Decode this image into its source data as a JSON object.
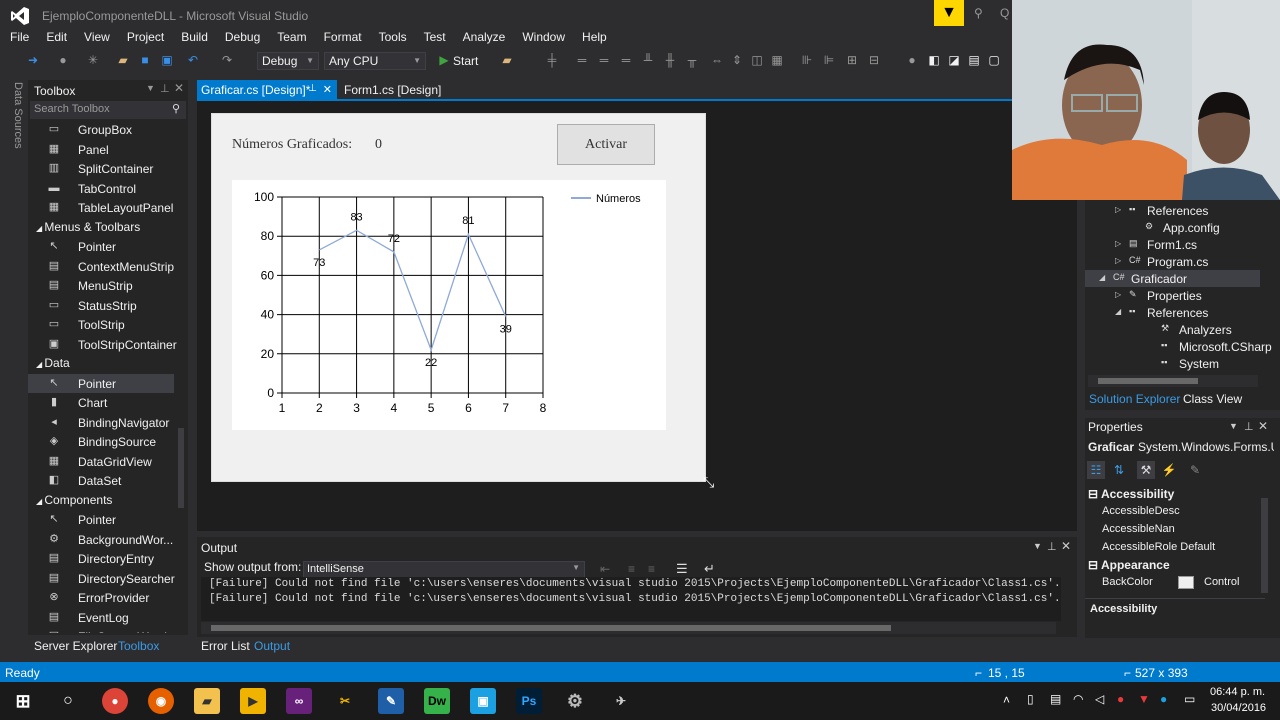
{
  "window": {
    "title": "EjemploComponenteDLL - Microsoft Visual Studio",
    "quick_launch": "Q"
  },
  "menu": [
    "File",
    "Edit",
    "View",
    "Project",
    "Build",
    "Debug",
    "Team",
    "Format",
    "Tools",
    "Test",
    "Analyze",
    "Window",
    "Help"
  ],
  "toolbar": {
    "config": "Debug",
    "platform": "Any CPU",
    "start_label": "Start"
  },
  "side_tab": "Data Sources",
  "toolbox": {
    "title": "Toolbox",
    "search_placeholder": "Search Toolbox",
    "items": [
      {
        "type": "item",
        "label": "GroupBox",
        "icon": "groupbox-icon",
        "glyph": "▭"
      },
      {
        "type": "item",
        "label": "Panel",
        "icon": "panel-icon",
        "glyph": "▦"
      },
      {
        "type": "item",
        "label": "SplitContainer",
        "icon": "splitcontainer-icon",
        "glyph": "▥"
      },
      {
        "type": "item",
        "label": "TabControl",
        "icon": "tabcontrol-icon",
        "glyph": "▬"
      },
      {
        "type": "item",
        "label": "TableLayoutPanel",
        "icon": "tablelayout-icon",
        "glyph": "▦"
      },
      {
        "type": "cat",
        "label": "Menus & Toolbars"
      },
      {
        "type": "item",
        "label": "Pointer",
        "icon": "pointer-icon",
        "glyph": "↖"
      },
      {
        "type": "item",
        "label": "ContextMenuStrip",
        "icon": "contextmenu-icon",
        "glyph": "▤"
      },
      {
        "type": "item",
        "label": "MenuStrip",
        "icon": "menustrip-icon",
        "glyph": "▤"
      },
      {
        "type": "item",
        "label": "StatusStrip",
        "icon": "statusstrip-icon",
        "glyph": "▭"
      },
      {
        "type": "item",
        "label": "ToolStrip",
        "icon": "toolstrip-icon",
        "glyph": "▭"
      },
      {
        "type": "item",
        "label": "ToolStripContainer",
        "icon": "toolstripcontainer-icon",
        "glyph": "▣"
      },
      {
        "type": "cat",
        "label": "Data"
      },
      {
        "type": "item",
        "label": "Pointer",
        "icon": "pointer-icon",
        "glyph": "↖",
        "selected": true
      },
      {
        "type": "item",
        "label": "Chart",
        "icon": "chart-icon",
        "glyph": "▮"
      },
      {
        "type": "item",
        "label": "BindingNavigator",
        "icon": "bindingnavigator-icon",
        "glyph": "◂"
      },
      {
        "type": "item",
        "label": "BindingSource",
        "icon": "bindingsource-icon",
        "glyph": "◈"
      },
      {
        "type": "item",
        "label": "DataGridView",
        "icon": "datagridview-icon",
        "glyph": "▦"
      },
      {
        "type": "item",
        "label": "DataSet",
        "icon": "dataset-icon",
        "glyph": "◧"
      },
      {
        "type": "cat",
        "label": "Components"
      },
      {
        "type": "item",
        "label": "Pointer",
        "icon": "pointer-icon",
        "glyph": "↖"
      },
      {
        "type": "item",
        "label": "BackgroundWor...",
        "icon": "backgroundworker-icon",
        "glyph": "⚙"
      },
      {
        "type": "item",
        "label": "DirectoryEntry",
        "icon": "directoryentry-icon",
        "glyph": "▤"
      },
      {
        "type": "item",
        "label": "DirectorySearcher",
        "icon": "directorysearcher-icon",
        "glyph": "▤"
      },
      {
        "type": "item",
        "label": "ErrorProvider",
        "icon": "errorprovider-icon",
        "glyph": "⊗"
      },
      {
        "type": "item",
        "label": "EventLog",
        "icon": "eventlog-icon",
        "glyph": "▤"
      },
      {
        "type": "item",
        "label": "FileSystemWatch...",
        "icon": "filesystemwatcher-icon",
        "glyph": "▤"
      }
    ]
  },
  "bottom_tabs": [
    "Server Explorer",
    "Toolbox"
  ],
  "doc_tabs": [
    "Graficar.cs [Design]*",
    "Form1.cs [Design]"
  ],
  "form": {
    "label": "Números Graficados:",
    "count": "0",
    "button": "Activar"
  },
  "chart_data": {
    "type": "line",
    "x": [
      1,
      2,
      3,
      4,
      5,
      6,
      7
    ],
    "series": [
      {
        "name": "Números",
        "values": [
          null,
          73,
          83,
          72,
          22,
          81,
          39
        ]
      }
    ],
    "data_labels": [
      "",
      "73",
      "83",
      "72",
      "22",
      "81",
      "39"
    ],
    "xlim": [
      1,
      8
    ],
    "ylim": [
      0,
      100
    ],
    "xticks": [
      "1",
      "2",
      "3",
      "4",
      "5",
      "6",
      "7",
      "8"
    ],
    "yticks": [
      "0",
      "20",
      "40",
      "60",
      "80",
      "100"
    ],
    "grid": true,
    "legend": "top-right",
    "line_color": "#8fa9d8"
  },
  "output": {
    "title": "Output",
    "show_from_label": "Show output from:",
    "source": "IntelliSense",
    "lines": [
      "[Failure] Could not find file 'c:\\users\\enseres\\documents\\visual studio 2015\\Projects\\EjemploComponenteDLL\\Graficador\\Class1.cs'.",
      "[Failure] Could not find file 'c:\\users\\enseres\\documents\\visual studio 2015\\Projects\\EjemploComponenteDLL\\Graficador\\Class1.cs'."
    ],
    "tabs": [
      "Error List",
      "Output"
    ]
  },
  "solution_explorer": {
    "items": [
      {
        "label": "References",
        "icon": "references-icon"
      },
      {
        "label": "App.config",
        "icon": "config-icon"
      },
      {
        "label": "Form1.cs",
        "icon": "form-icon"
      },
      {
        "label": "Program.cs",
        "icon": "csharp-icon"
      },
      {
        "label": "Graficador",
        "icon": "csharp-project-icon"
      },
      {
        "label": "Properties",
        "icon": "wrench-icon"
      },
      {
        "label": "References",
        "icon": "references-icon"
      },
      {
        "label": "Analyzers",
        "icon": "analyzers-icon"
      },
      {
        "label": "Microsoft.CSharp",
        "icon": "assembly-icon"
      },
      {
        "label": "System",
        "icon": "assembly-icon"
      }
    ],
    "tabs": [
      "Solution Explorer",
      "Class View"
    ]
  },
  "properties": {
    "title": "Properties",
    "object": "Graficar",
    "type": "System.Windows.Forms.U",
    "categories": {
      "accessibility": "Accessibility",
      "appearance": "Appearance"
    },
    "rows": [
      {
        "name": "AccessibleDesc",
        "value": ""
      },
      {
        "name": "AccessibleNan",
        "value": ""
      },
      {
        "name": "AccessibleRole",
        "value": "Default"
      }
    ],
    "backcolor": {
      "name": "BackColor",
      "value": "Control"
    },
    "description": "Accessibility"
  },
  "status": {
    "ready": "Ready",
    "position": "15 , 15",
    "size": "527 x 393"
  },
  "taskbar": {
    "time": "06:44 p. m.",
    "date": "30/04/2016"
  },
  "colors": {
    "accent": "#007acc",
    "background": "#2d2d30",
    "panel": "#252526"
  }
}
